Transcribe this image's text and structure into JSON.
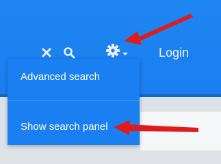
{
  "header": {
    "icons": [
      "close-icon",
      "search-icon",
      "gear-icon",
      "caret-down-icon"
    ],
    "login_label": "Login"
  },
  "dropdown": {
    "items": [
      {
        "label": "Advanced search"
      },
      {
        "label": "Show search panel"
      }
    ]
  },
  "colors": {
    "header_blue": "#1a7ef0",
    "menu_blue": "#1a7ff0",
    "annotation_red": "#e01b1b",
    "icon_white": "#e9eef6"
  }
}
